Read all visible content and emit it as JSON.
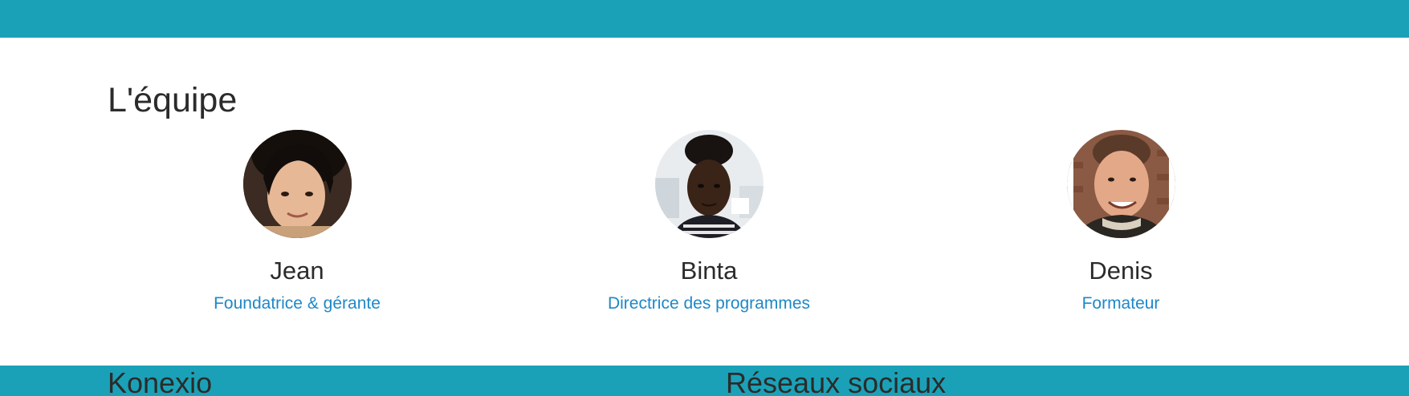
{
  "colors": {
    "brand_bar": "#1ba1b7",
    "role_text": "#1e88c7",
    "heading_text": "#2b2b2b"
  },
  "team": {
    "title": "L'équipe",
    "members": [
      {
        "name": "Jean",
        "role": "Foundatrice & gérante",
        "avatar": "avatar-photo-woman"
      },
      {
        "name": "Binta",
        "role": "Directrice des programmes",
        "avatar": "avatar-photo-woman"
      },
      {
        "name": "Denis",
        "role": "Formateur",
        "avatar": "avatar-photo-man"
      }
    ]
  },
  "footer": {
    "col1_title": "Konexio",
    "col2_title": "Réseaux sociaux"
  }
}
